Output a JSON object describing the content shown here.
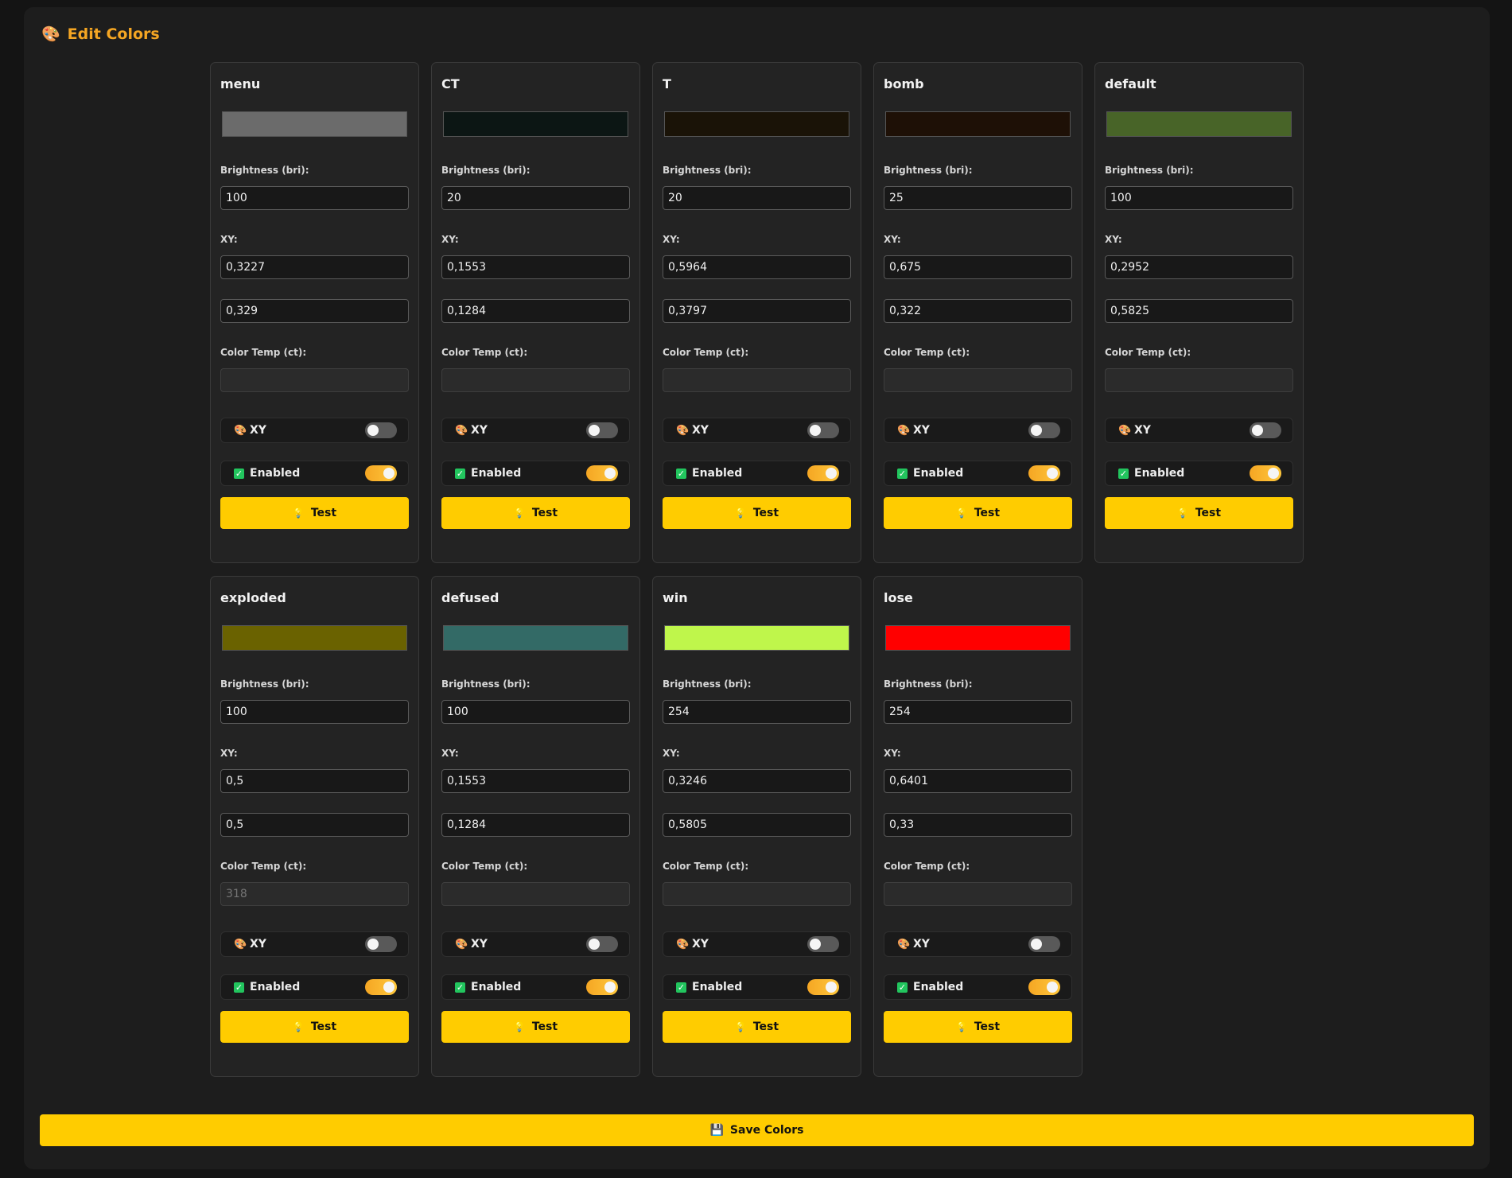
{
  "title": "Edit Colors",
  "icons": {
    "title": "🎨",
    "xy_toggle": "🎨",
    "enabled": "✓",
    "test": "💡",
    "save": "💾"
  },
  "labels": {
    "brightness": "Brightness (bri):",
    "xy": "XY:",
    "color_temp": "Color Temp (ct):",
    "xy_toggle": "XY",
    "enabled": "Enabled",
    "test": "Test"
  },
  "save_label": "Save Colors",
  "colors": [
    {
      "name": "menu",
      "swatch": "#6b6b6b",
      "bri": "100",
      "x": "0,3227",
      "y": "0,329",
      "ct": "",
      "xy_mode": false,
      "enabled": true
    },
    {
      "name": "CT",
      "swatch": "#0c1614",
      "bri": "20",
      "x": "0,1553",
      "y": "0,1284",
      "ct": "",
      "xy_mode": false,
      "enabled": true
    },
    {
      "name": "T",
      "swatch": "#1a1307",
      "bri": "20",
      "x": "0,5964",
      "y": "0,3797",
      "ct": "",
      "xy_mode": false,
      "enabled": true
    },
    {
      "name": "bomb",
      "swatch": "#1e1006",
      "bri": "25",
      "x": "0,675",
      "y": "0,322",
      "ct": "",
      "xy_mode": false,
      "enabled": true
    },
    {
      "name": "default",
      "swatch": "#486428",
      "bri": "100",
      "x": "0,2952",
      "y": "0,5825",
      "ct": "",
      "xy_mode": false,
      "enabled": true
    },
    {
      "name": "exploded",
      "swatch": "#6a6200",
      "bri": "100",
      "x": "0,5",
      "y": "0,5",
      "ct": "318",
      "xy_mode": false,
      "enabled": true
    },
    {
      "name": "defused",
      "swatch": "#336a66",
      "bri": "100",
      "x": "0,1553",
      "y": "0,1284",
      "ct": "",
      "xy_mode": false,
      "enabled": true
    },
    {
      "name": "win",
      "swatch": "#bff64b",
      "bri": "254",
      "x": "0,3246",
      "y": "0,5805",
      "ct": "",
      "xy_mode": false,
      "enabled": true
    },
    {
      "name": "lose",
      "swatch": "#ff0000",
      "bri": "254",
      "x": "0,6401",
      "y": "0,33",
      "ct": "",
      "xy_mode": false,
      "enabled": true
    }
  ]
}
